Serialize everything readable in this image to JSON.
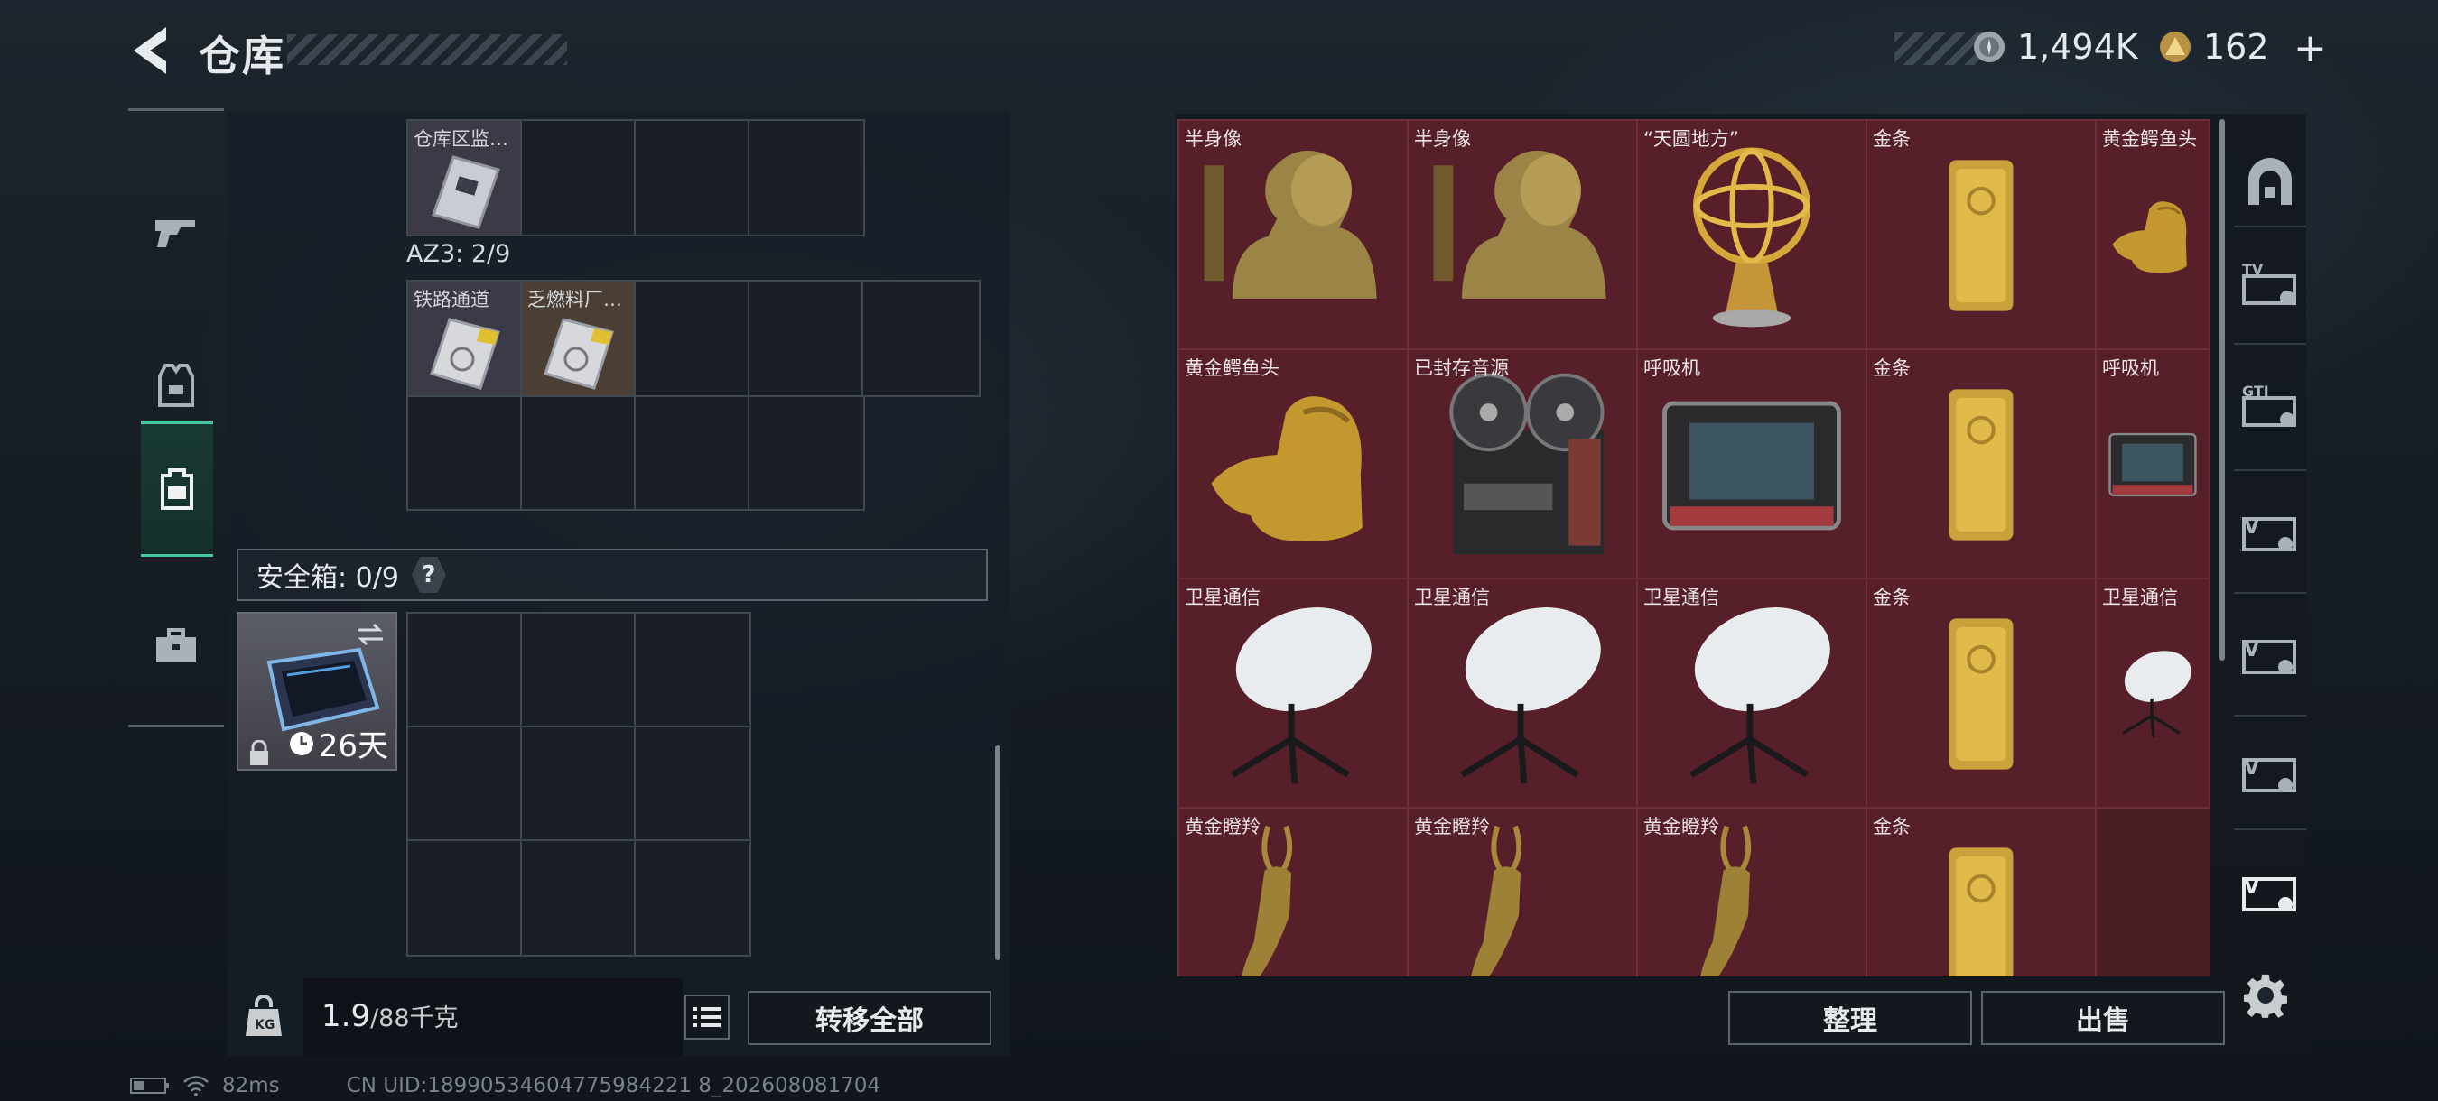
{
  "header": {
    "title": "仓库",
    "currency1": "1,494K",
    "currency2": "162",
    "plus_label": "+"
  },
  "left_nav": {
    "items": [
      {
        "icon": "gun-icon",
        "active": false
      },
      {
        "icon": "vest-icon",
        "active": false
      },
      {
        "icon": "backpack-icon",
        "active": true
      },
      {
        "icon": "case-icon",
        "active": false
      }
    ]
  },
  "storage": {
    "grid_a_items": [
      {
        "label": "仓库区监…"
      }
    ],
    "az3_label": "AZ3: 2/9",
    "grid_b_items": [
      {
        "label": "铁路通道"
      },
      {
        "label": "乏燃料厂…"
      }
    ],
    "safebox_label": "安全箱: 0/9",
    "help_label": "?",
    "case_days": "26天",
    "weight_current": "1.9",
    "weight_max": "/88千克",
    "transfer_all": "转移全部"
  },
  "items": [
    {
      "label": "半身像",
      "kind": "bust"
    },
    {
      "label": "半身像",
      "kind": "bust"
    },
    {
      "label": "“天圆地方”",
      "kind": "globe"
    },
    {
      "label": "金条",
      "kind": "gold"
    },
    {
      "label": "黄金鳄鱼头",
      "kind": "croc"
    },
    {
      "label": "黄金鳄鱼头",
      "kind": "croc"
    },
    {
      "label": "已封存音源",
      "kind": "tape"
    },
    {
      "label": "呼吸机",
      "kind": "vent"
    },
    {
      "label": "金条",
      "kind": "gold"
    },
    {
      "label": "呼吸机",
      "kind": "vent"
    },
    {
      "label": "卫星通信",
      "kind": "dish"
    },
    {
      "label": "卫星通信",
      "kind": "dish"
    },
    {
      "label": "卫星通信",
      "kind": "dish"
    },
    {
      "label": "金条",
      "kind": "gold"
    },
    {
      "label": "卫星通信",
      "kind": "dish"
    },
    {
      "label": "黄金瞪羚",
      "kind": "gazelle"
    },
    {
      "label": "黄金瞪羚",
      "kind": "gazelle"
    },
    {
      "label": "黄金瞪羚",
      "kind": "gazelle"
    },
    {
      "label": "金条",
      "kind": "gold"
    }
  ],
  "actions": {
    "sort": "整理",
    "sell": "出售"
  },
  "status": {
    "ping": "82ms",
    "uid": "CN UID:18990534604775984221 8_202608081704"
  },
  "colors": {
    "accent": "#46c79f",
    "item_bg": "#561f29",
    "gold": "#c9a23c"
  }
}
